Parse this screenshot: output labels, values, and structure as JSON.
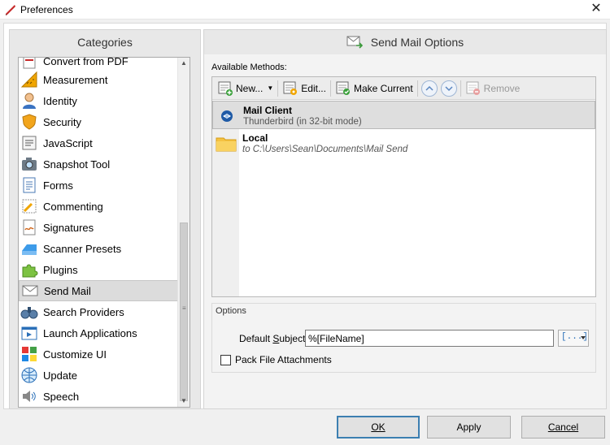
{
  "window": {
    "title": "Preferences"
  },
  "categories": {
    "header": "Categories",
    "items": [
      {
        "label": "Convert from PDF",
        "icon": "convert-icon"
      },
      {
        "label": "Measurement",
        "icon": "ruler-icon"
      },
      {
        "label": "Identity",
        "icon": "person-icon"
      },
      {
        "label": "Security",
        "icon": "shield-icon"
      },
      {
        "label": "JavaScript",
        "icon": "script-icon"
      },
      {
        "label": "Snapshot Tool",
        "icon": "camera-icon"
      },
      {
        "label": "Forms",
        "icon": "form-icon"
      },
      {
        "label": "Commenting",
        "icon": "comment-icon"
      },
      {
        "label": "Signatures",
        "icon": "signature-icon"
      },
      {
        "label": "Scanner Presets",
        "icon": "scanner-icon"
      },
      {
        "label": "Plugins",
        "icon": "puzzle-icon"
      },
      {
        "label": "Send Mail",
        "icon": "mail-icon"
      },
      {
        "label": "Search Providers",
        "icon": "binoculars-icon"
      },
      {
        "label": "Launch Applications",
        "icon": "launch-icon"
      },
      {
        "label": "Customize UI",
        "icon": "palette-icon"
      },
      {
        "label": "Update",
        "icon": "globe-icon"
      },
      {
        "label": "Speech",
        "icon": "speaker-icon"
      }
    ],
    "selected": "Send Mail"
  },
  "panel": {
    "header": "Send Mail Options",
    "available_label": "Available Methods:",
    "toolbar": {
      "new_label": "New...",
      "edit_label": "Edit...",
      "make_current_label": "Make Current",
      "remove_label": "Remove"
    },
    "methods": [
      {
        "title": "Mail Client",
        "subtitle": "Thunderbird (in 32-bit mode)",
        "icon": "thunderbird-icon"
      },
      {
        "title": "Local",
        "subtitle": "to C:\\Users\\Sean\\Documents\\Mail Send",
        "icon": "folder-icon"
      }
    ],
    "options": {
      "label": "Options",
      "default_subject_label": "Default Subject:",
      "default_subject_value": "%[FileName]",
      "pack_attachments_label": "Pack File Attachments",
      "pack_attachments_checked": false
    }
  },
  "buttons": {
    "ok": "OK",
    "apply": "Apply",
    "cancel": "Cancel"
  },
  "colors": {
    "accent": "#3c7fb1",
    "folder": "#f5c242"
  }
}
